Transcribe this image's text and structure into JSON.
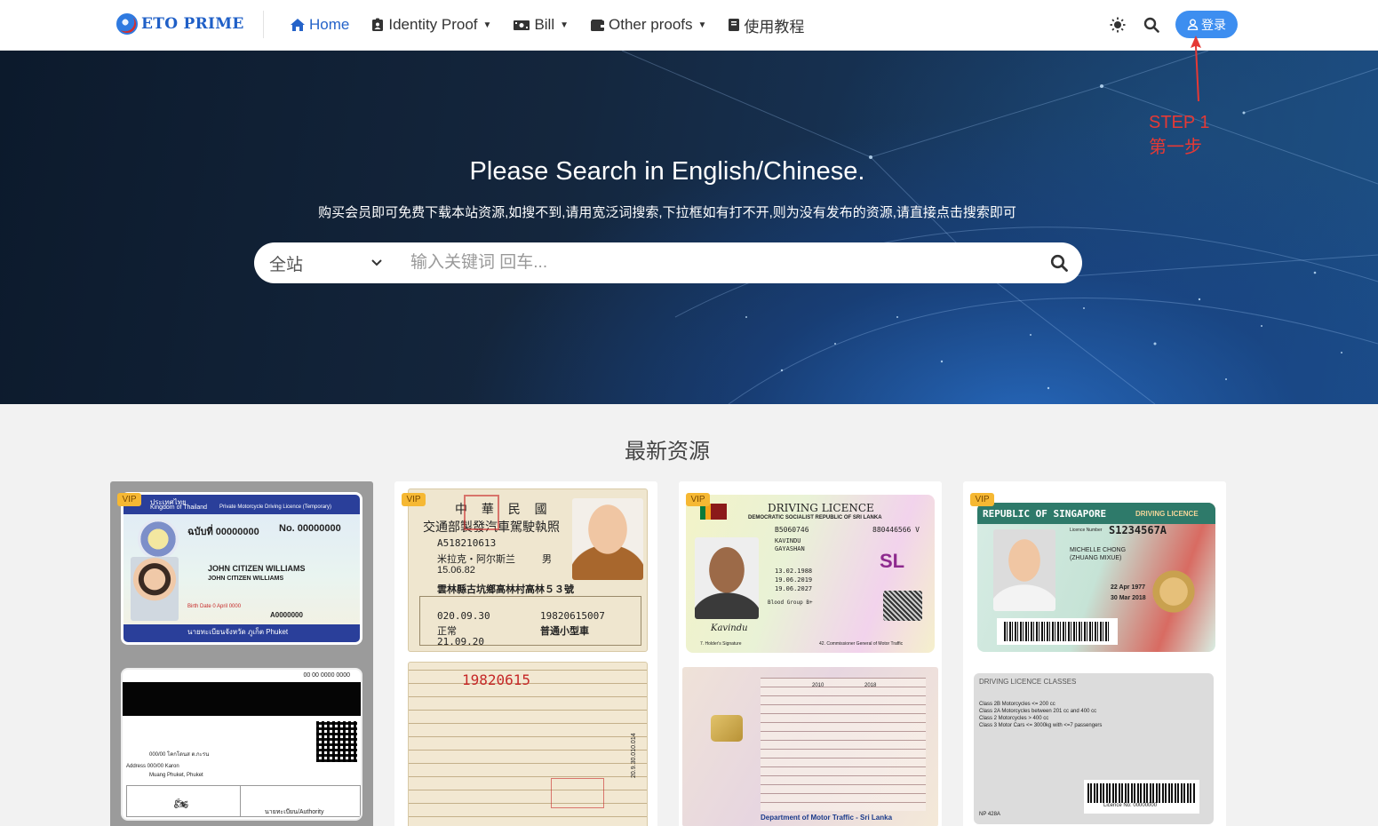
{
  "brand": {
    "logo_text": "ETO PRIME"
  },
  "nav": {
    "items": [
      {
        "label": "Home",
        "icon": "home-icon",
        "active": true,
        "dropdown": false
      },
      {
        "label": "Identity Proof",
        "icon": "id-card-icon",
        "active": false,
        "dropdown": true
      },
      {
        "label": "Bill",
        "icon": "money-bill-icon",
        "active": false,
        "dropdown": true
      },
      {
        "label": "Other proofs",
        "icon": "wallet-icon",
        "active": false,
        "dropdown": true
      },
      {
        "label": "使用教程",
        "icon": "book-icon",
        "active": false,
        "dropdown": false
      }
    ],
    "login_label": "登录"
  },
  "hero": {
    "title": "Please Search in English/Chinese.",
    "subtitle": "购买会员即可免费下载本站资源,如搜不到,请用宽泛词搜索,下拉框如有打不开,则为没有发布的资源,请直接点击搜索即可",
    "search_scope": "全站",
    "search_placeholder": "输入关键词 回车..."
  },
  "annotation": {
    "line1": "STEP 1",
    "line2": "第一步"
  },
  "section": {
    "title": "最新资源"
  },
  "cards": [
    {
      "badge": "VIP",
      "front": {
        "header_th": "ประเทศไทย",
        "header_en": "Kingdom of Thailand",
        "title": "Private Motorcycle Driving Licence (Temporary)",
        "number": "No. 00000000",
        "id": "ฉบับที่ 00000000",
        "name_th": "JOHN CITIZEN WILLIAMS",
        "name_en": "JOHN CITIZEN WILLIAMS",
        "birth": "Birth Date  0 April 0000",
        "code": "A0000000",
        "footer": "นายทะเบียนจังหวัด ภูเก็ต Phuket"
      },
      "back": {
        "number": "00 00 0000 0000",
        "address_th": "000/00 โคกโดนส ต.กะรน",
        "address_en": "Address 000/00 Karon",
        "city": "Muang Phuket, Phuket",
        "authority": "นายทะเบียน/Authority"
      }
    },
    {
      "badge": "VIP",
      "front": {
        "country": "中 華 民 國",
        "title": "交通部製發汽車駕駛執照",
        "number": "A518210613",
        "name": "米拉克・阿尔斯兰",
        "sex": "男",
        "birth": "15.06.82",
        "address": "雲林縣古坑鄉高林村高林５３號",
        "issue": "020.09.30",
        "serial": "19820615007",
        "status": "正常",
        "class": "普通小型車",
        "expire": "21.09.20"
      },
      "back": {
        "number": "19820615",
        "side_code": "20.9.30.010.014"
      }
    },
    {
      "badge": "VIP",
      "front": {
        "title": "DRIVING LICENCE",
        "subtitle": "DEMOCRATIC SOCIALIST REPUBLIC OF SRI LANKA",
        "number": "B5060746",
        "id": "880446566 V",
        "name1": "KAVINDU",
        "name2": "GAYASHAN",
        "code": "SL",
        "date1": "13.02.1988",
        "date2": "19.06.2019",
        "date3": "19.06.2027",
        "blood": "Blood Group B+",
        "signature": "Kavindu",
        "footer_left": "7. Holder's Signature",
        "footer_right": "42. Commissioner General of Motor Traffic"
      },
      "back": {
        "dates": [
          "2010",
          "2018"
        ],
        "footer": "Department of Motor Traffic - Sri Lanka"
      }
    },
    {
      "badge": "VIP",
      "front": {
        "title": "REPUBLIC OF SINGAPORE",
        "subtitle": "DRIVING LICENCE",
        "number_label": "Licence Number",
        "number": "S1234567A",
        "name": "MICHELLE CHONG",
        "alias": "(ZHUANG MIXUE)",
        "birth": "22 Apr 1977",
        "issue": "30 Mar 2018"
      },
      "back": {
        "title": "DRIVING LICENCE CLASSES",
        "lines": [
          "Class 2B  Motorcycles <= 200 cc",
          "Class 2A  Motorcycles between 201 cc and 400 cc",
          "Class 2   Motorcycles > 400 cc",
          "Class 3   Motor Cars <= 3000kg with <=7 passengers"
        ],
        "licence_no": "Licence No: 00000000",
        "code": "NP 428A"
      }
    }
  ],
  "colors": {
    "accent": "#2563c9",
    "login_bg": "#3d8ef0",
    "annotation": "#e53935",
    "vip": "#f6b833"
  }
}
